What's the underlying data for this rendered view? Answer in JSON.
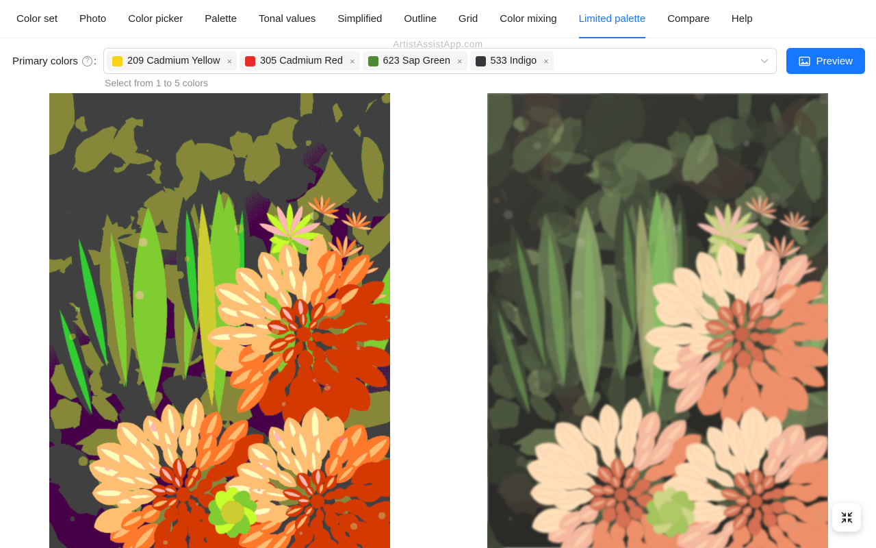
{
  "tabs": [
    {
      "label": "Color set",
      "active": false
    },
    {
      "label": "Photo",
      "active": false
    },
    {
      "label": "Color picker",
      "active": false
    },
    {
      "label": "Palette",
      "active": false
    },
    {
      "label": "Tonal values",
      "active": false
    },
    {
      "label": "Simplified",
      "active": false
    },
    {
      "label": "Outline",
      "active": false
    },
    {
      "label": "Grid",
      "active": false
    },
    {
      "label": "Color mixing",
      "active": false
    },
    {
      "label": "Limited palette",
      "active": true
    },
    {
      "label": "Compare",
      "active": false
    },
    {
      "label": "Help",
      "active": false
    }
  ],
  "watermark": "ArtistAssistApp.com",
  "controls": {
    "label": "Primary colors",
    "label_suffix": ":",
    "help_icon": "question-circle-icon",
    "hint": "Select from 1 to 5 colors",
    "dropdown_icon": "chevron-down-icon",
    "chips": [
      {
        "code": "209",
        "name": "Cadmium Yellow",
        "label": "209 Cadmium Yellow",
        "color": "#fbd214",
        "remove_label": "×"
      },
      {
        "code": "305",
        "name": "Cadmium Red",
        "label": "305 Cadmium Red",
        "color": "#e82c2a",
        "remove_label": "×"
      },
      {
        "code": "623",
        "name": "Sap Green",
        "label": "623 Sap Green",
        "color": "#4e8a34",
        "remove_label": "×"
      },
      {
        "code": "533",
        "name": "Indigo",
        "label": "533 Indigo",
        "color": "#33373c",
        "remove_label": "×"
      }
    ],
    "preview_button": {
      "label": "Preview",
      "icon": "image-picture-icon",
      "color": "#1677ff"
    }
  },
  "images": {
    "left": {
      "alt": "Limited palette rendering of orange dahlia flowers",
      "style": "posterized"
    },
    "right": {
      "alt": "Original photo of orange dahlia flowers",
      "style": "photo"
    }
  },
  "fab": {
    "icon": "compress-arrows-icon",
    "label": "Exit full screen"
  },
  "colors": {
    "accent": "#1677ff",
    "border": "#d9d9d9",
    "chip_bg": "#f5f5f5",
    "text": "rgba(0,0,0,0.88)",
    "muted": "rgba(0,0,0,0.45)",
    "watermark": "#bfbfbf"
  }
}
